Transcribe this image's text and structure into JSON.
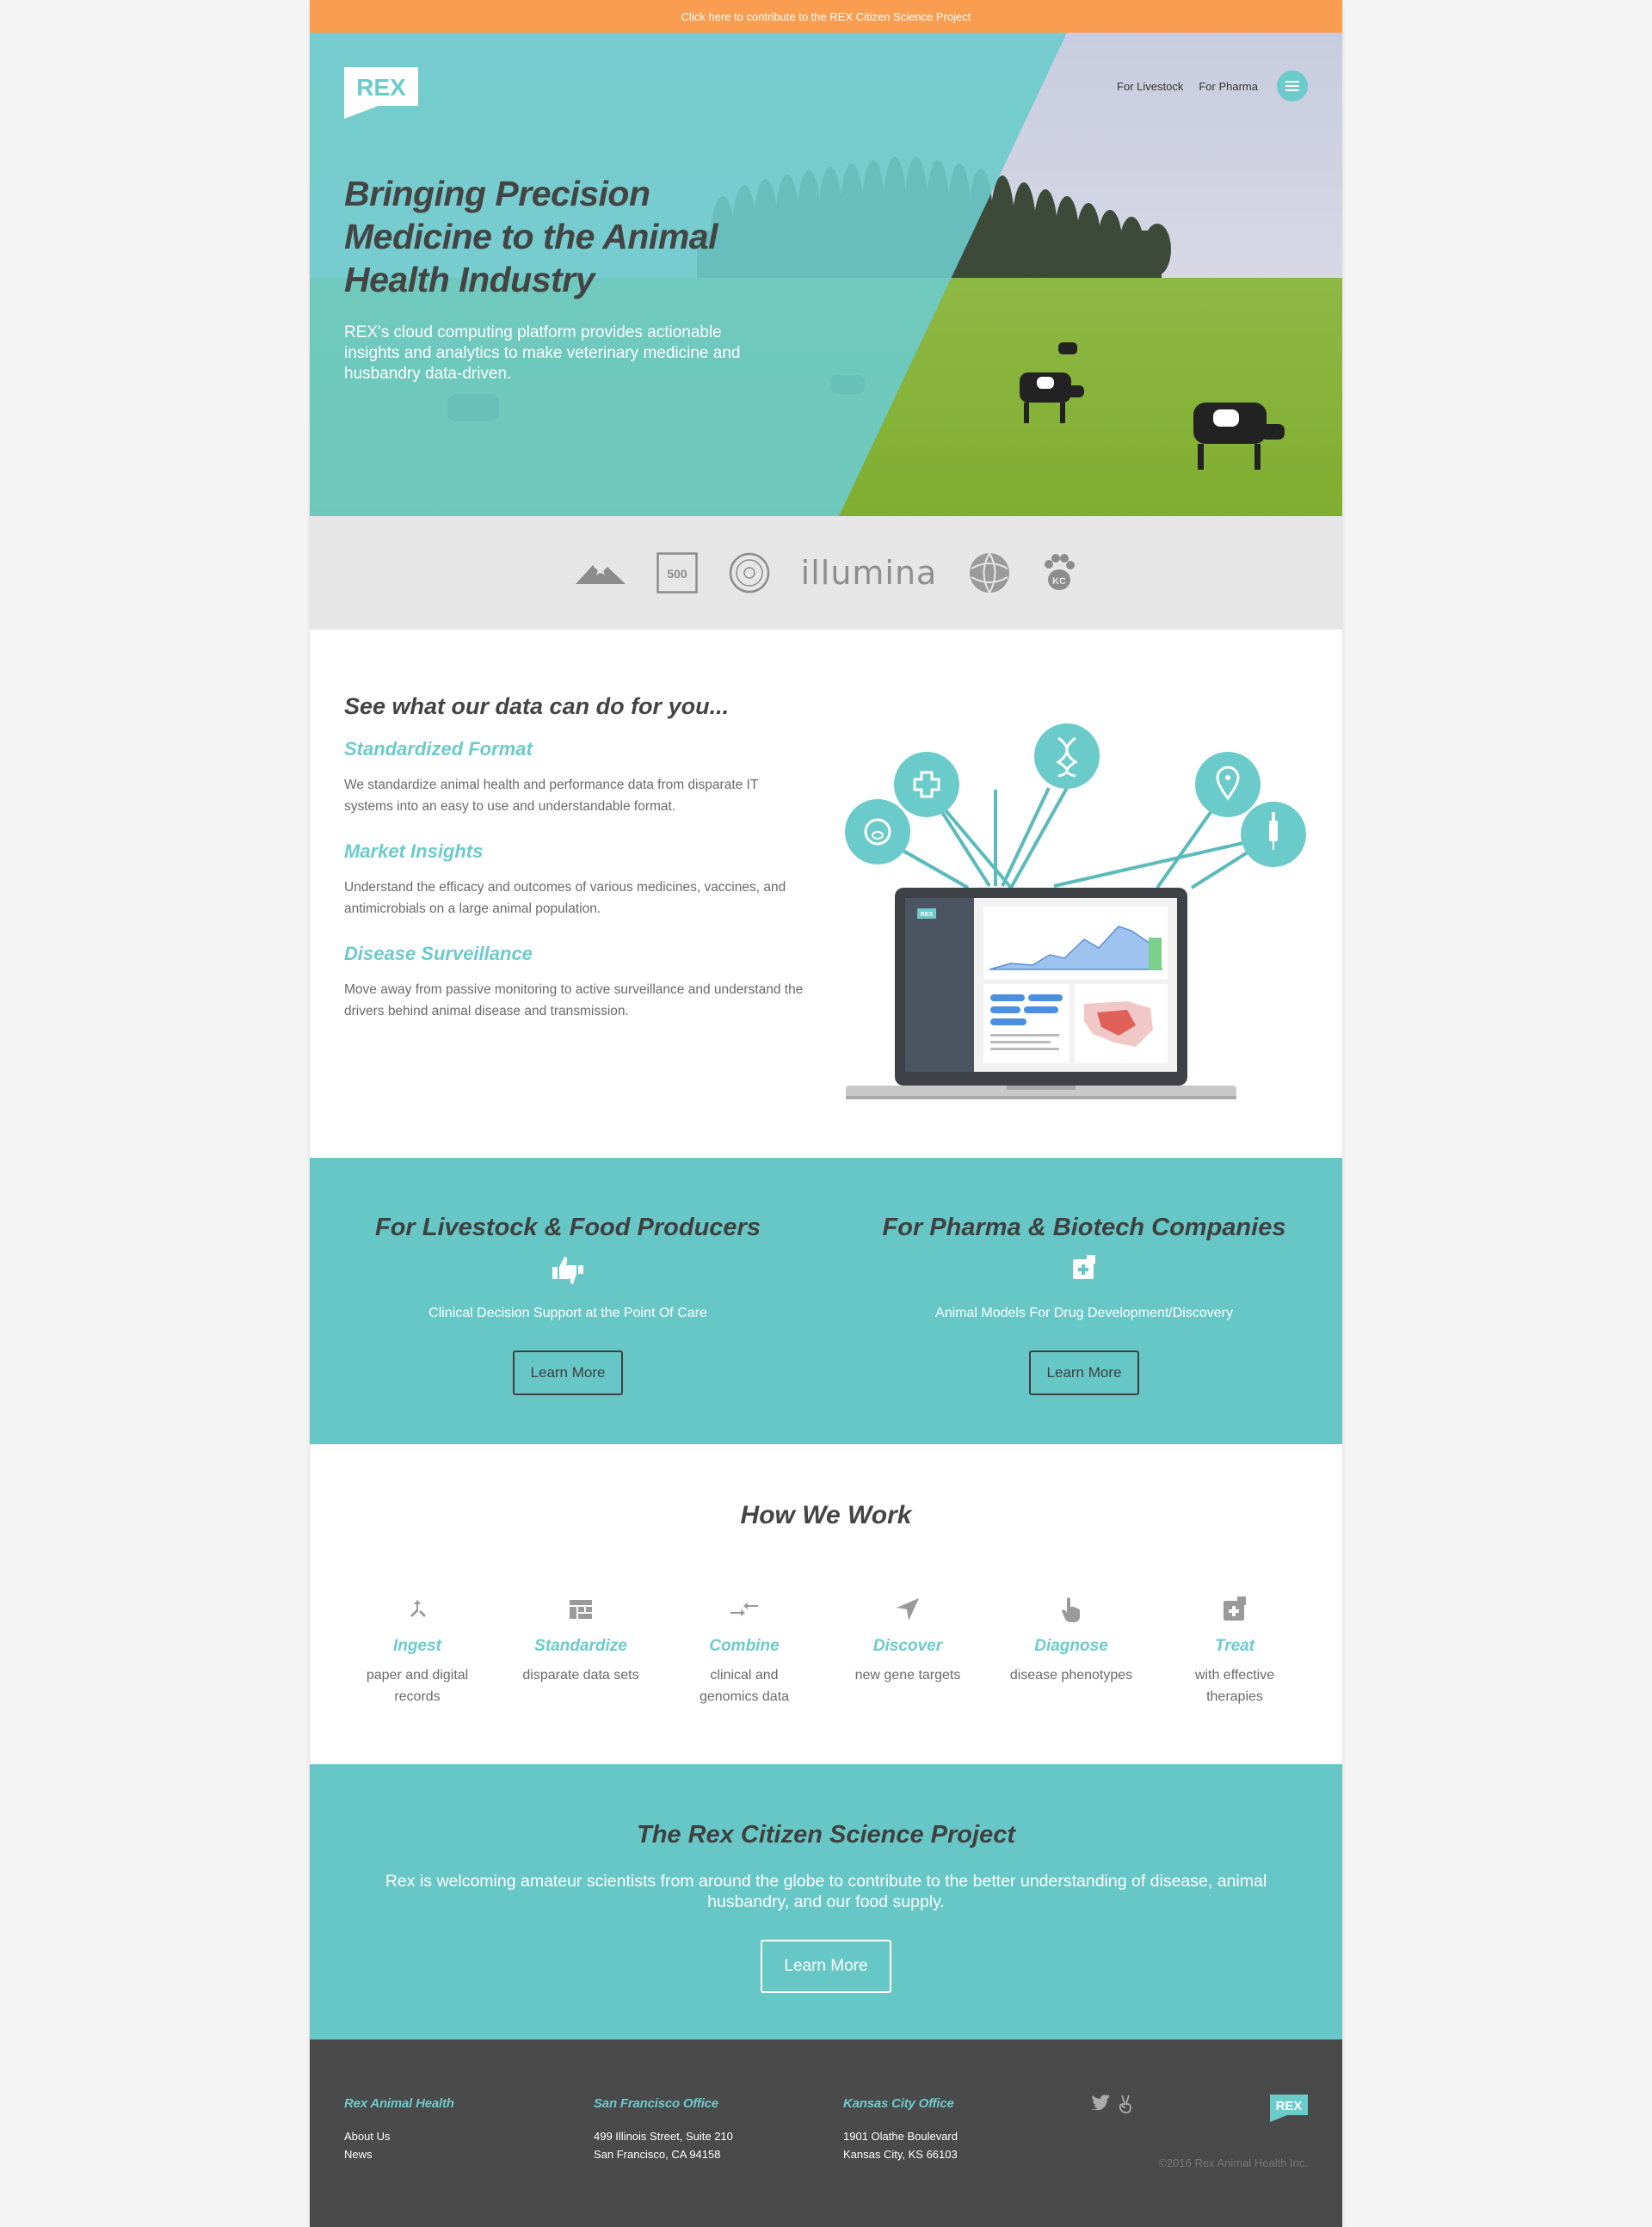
{
  "banner": {
    "text": "Click here to contribute to the REX Citizen Science Project"
  },
  "nav": {
    "logo_text": "REX",
    "livestock": "For Livestock",
    "pharma": "For Pharma",
    "menu_icon": "hamburger-menu-icon"
  },
  "hero": {
    "title": "Bringing Precision Medicine to the Animal Health Industry",
    "subtitle": "REX's cloud computing platform provides actionable insights and analytics to make veterinary medicine and husbandry data-driven."
  },
  "partners": {
    "items": [
      "mountain-logo",
      "500-logo",
      "seal-logo",
      "illumina",
      "globe-logo",
      "paw-kc-logo"
    ],
    "box_text": "500",
    "illumina_text": "illumina",
    "paw_text": "KC"
  },
  "features": {
    "heading": "See what our data can do for you...",
    "items": [
      {
        "title": "Standardized Format",
        "text": "We standardize animal health and performance data from disparate IT systems into an easy to use and understandable format."
      },
      {
        "title": "Market Insights",
        "text": "Understand the efficacy and outcomes of various medicines, vaccines, and antimicrobials on a large animal population."
      },
      {
        "title": "Disease Surveillance",
        "text": "Move away from passive monitoring to active surveillance and understand the drivers behind animal disease and transmission."
      }
    ],
    "diagram_icons": [
      "pig-icon",
      "medical-cross-icon",
      "dna-icon",
      "location-pin-icon",
      "syringe-icon"
    ],
    "laptop_logo": "REX"
  },
  "audiences": [
    {
      "title": "For Livestock & Food Producers",
      "icon": "thumbs-up-down-icon",
      "text": "Clinical Decision Support at the Point Of Care",
      "button": "Learn More"
    },
    {
      "title": "For Pharma & Biotech Companies",
      "icon": "medical-plus-icon",
      "text": "Animal Models For Drug Development/Discovery",
      "button": "Learn More"
    }
  ],
  "how": {
    "heading": "How We Work",
    "steps": [
      {
        "title": "Ingest",
        "text": "paper and digital records",
        "icon": "merge-arrow-icon"
      },
      {
        "title": "Standardize",
        "text": "disparate data sets",
        "icon": "grid-layout-icon"
      },
      {
        "title": "Combine",
        "text": "clinical and genomics data",
        "icon": "swap-arrows-icon"
      },
      {
        "title": "Discover",
        "text": "new gene targets",
        "icon": "navigation-arrow-icon"
      },
      {
        "title": "Diagnose",
        "text": "disease phenotypes",
        "icon": "pointer-hand-icon"
      },
      {
        "title": "Treat",
        "text": "with effective therapies",
        "icon": "medical-plus-icon"
      }
    ]
  },
  "citizen": {
    "heading": "The Rex Citizen Science Project",
    "text": "Rex is welcoming amateur scientists from around the globe to contribute to the better understanding of disease, animal husbandry, and our food supply.",
    "button": "Learn More"
  },
  "footer": {
    "col1": {
      "title": "Rex Animal Health",
      "links": [
        "About Us",
        "News"
      ]
    },
    "col2": {
      "title": "San Francisco Office",
      "lines": [
        "499 Illinois Street, Suite 210",
        "San Francisco, CA 94158"
      ]
    },
    "col3": {
      "title": "Kansas City Office",
      "lines": [
        "1901 Olathe Boulevard",
        "Kansas City, KS 66103"
      ]
    },
    "social": [
      "twitter-icon",
      "angellist-icon"
    ],
    "logo_text": "REX",
    "copyright": "©2016 Rex Animal Health Inc."
  },
  "colors": {
    "accent": "#6bcbcb",
    "banner": "#f99d51",
    "footer": "#4a4a4a",
    "dark_text": "#444444"
  }
}
